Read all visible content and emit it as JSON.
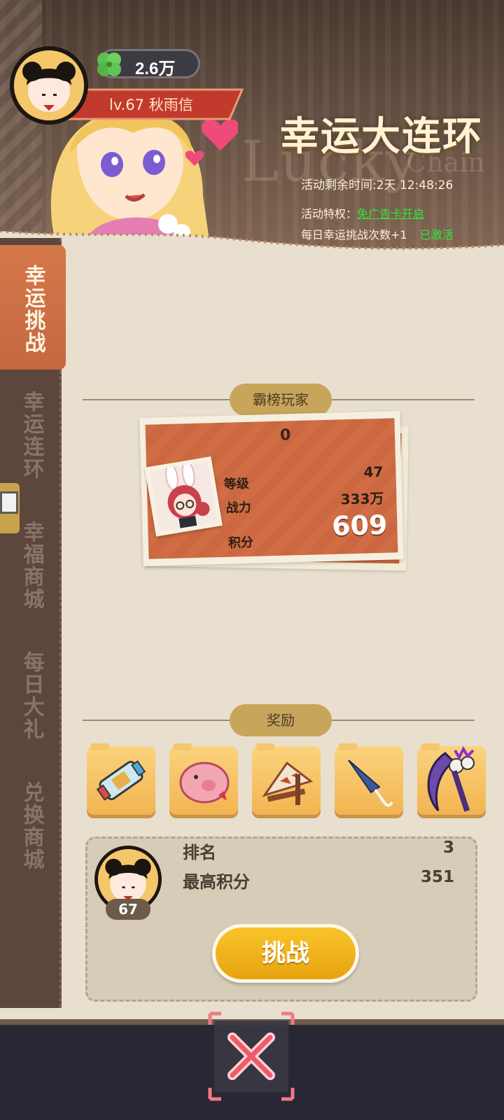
{
  "player": {
    "currency": "2.6万",
    "level_name": "lv.67  秋雨信"
  },
  "event": {
    "title": "幸运大连环",
    "watermark_main": "Lucky",
    "watermark_sub": "Chain",
    "remaining_time": "活动剩余时间:2天 12:48:26",
    "privilege_label": "活动特权：",
    "privilege_link": "免广告卡开启",
    "daily_bonus": "每日幸运挑战次数+1",
    "daily_status": "已激活"
  },
  "sidenav": {
    "items": [
      {
        "label": "幸运挑战",
        "active": true
      },
      {
        "label": "幸运连环",
        "active": false
      },
      {
        "label": "幸福商城",
        "active": false
      },
      {
        "label": "每日大礼",
        "active": false
      },
      {
        "label": "兑换商城",
        "active": false
      }
    ]
  },
  "top_player": {
    "section_title": "霸榜玩家",
    "rank": "0",
    "level_label": "等级",
    "level_value": "47",
    "power_label": "战力",
    "power_value": "333万",
    "score_label": "积分",
    "score_value": "609"
  },
  "rewards": {
    "section_title": "奖励",
    "items": [
      "scroll-reward-icon",
      "pig-reward-icon",
      "fan-reward-icon",
      "umbrella-reward-icon",
      "scythe-reward-icon"
    ]
  },
  "my_info": {
    "level": "67",
    "rank_label": "排名",
    "rank_value": "3",
    "best_label": "最高积分",
    "best_value": "351",
    "challenge_label": "挑战"
  },
  "colors": {
    "accent_orange": "#c9643c",
    "gold": "#c7a55a",
    "green": "#34e33b",
    "button_yellow": "#f8c42b"
  }
}
